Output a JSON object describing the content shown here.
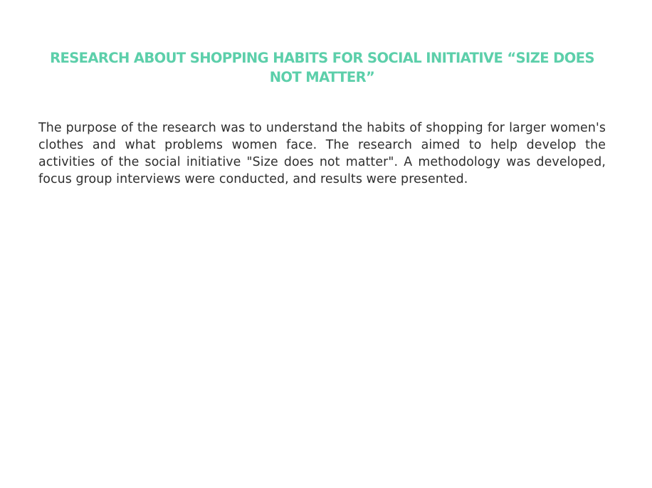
{
  "document": {
    "title": "RESEARCH ABOUT SHOPPING HABITS FOR SOCIAL INITIATIVE “SIZE DOES NOT MATTER”",
    "paragraph": "The purpose of the research was to understand the habits of shopping for larger women's clothes and what problems women face. The research aimed to help develop the activities of the social initiative \"Size does not matter\". A methodology was developed, focus group interviews were conducted, and results were presented."
  },
  "colors": {
    "title": "#5ccfaa",
    "text": "#2e2e2e",
    "background": "#ffffff"
  }
}
